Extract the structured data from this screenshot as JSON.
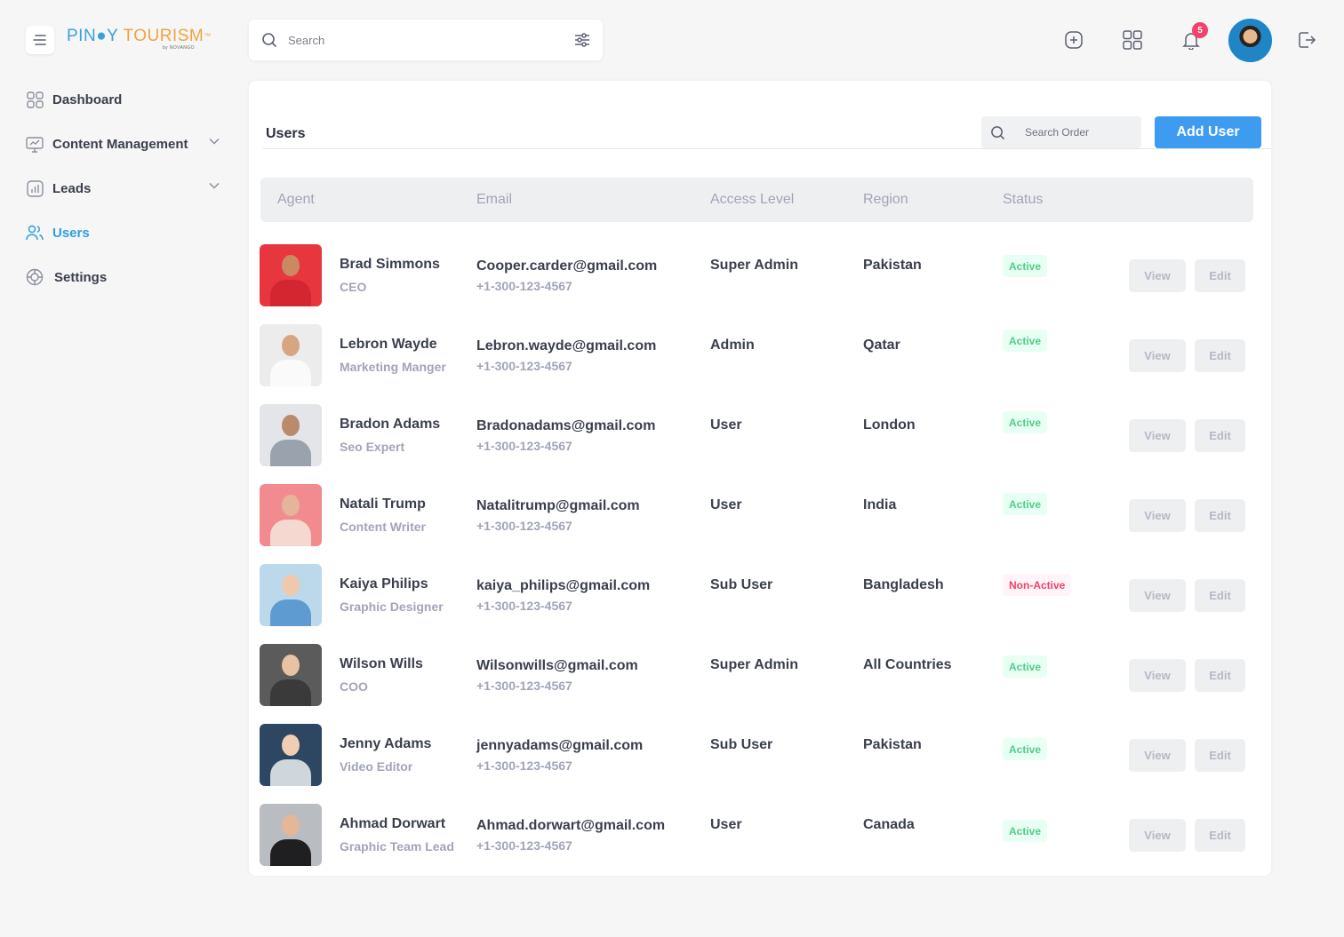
{
  "brand": {
    "part1": "PIN",
    "part2": "Y",
    "part3": "TOURISM",
    "tm": "™",
    "sub": "by NOVANGO"
  },
  "nav": [
    {
      "label": "Dashboard",
      "icon": "dashboard-grid-icon",
      "active": false
    },
    {
      "label": "Content Management",
      "icon": "monitor-icon",
      "active": false,
      "expandable": true
    },
    {
      "label": "Leads",
      "icon": "chart-icon",
      "active": false,
      "expandable": true
    },
    {
      "label": "Users",
      "icon": "users-icon",
      "active": true
    },
    {
      "label": "Settings",
      "icon": "settings-icon",
      "active": false
    }
  ],
  "topbar": {
    "search_placeholder": "Search",
    "notifications_count": "5"
  },
  "users_page": {
    "title": "Users",
    "search_placeholder": "Search Order",
    "add_button": "Add User",
    "columns": {
      "agent": "Agent",
      "email": "Email",
      "access": "Access Level",
      "region": "Region",
      "status": "Status"
    },
    "view_label": "View",
    "edit_label": "Edit",
    "rows": [
      {
        "name": "Brad Simmons",
        "role": "CEO",
        "email": "Cooper.carder@gmail.com",
        "phone": "+1-300-123-4567",
        "access": "Super Admin",
        "region": "Pakistan",
        "status": "Active",
        "active": true,
        "photo_bg": "#e8363f",
        "photo_skin": "#c98a63",
        "photo_shirt": "#d42630"
      },
      {
        "name": "Lebron Wayde",
        "role": "Marketing Manger",
        "email": "Lebron.wayde@gmail.com",
        "phone": "+1-300-123-4567",
        "access": "Admin",
        "region": "Qatar",
        "status": "Active",
        "active": true,
        "photo_bg": "#ececec",
        "photo_skin": "#d8a582",
        "photo_shirt": "#fafafa"
      },
      {
        "name": "Bradon Adams",
        "role": "Seo Expert",
        "email": "Bradonadams@gmail.com",
        "phone": "+1-300-123-4567",
        "access": "User",
        "region": "London",
        "status": "Active",
        "active": true,
        "photo_bg": "#e3e5e8",
        "photo_skin": "#b98a6c",
        "photo_shirt": "#9aa3ad"
      },
      {
        "name": "Natali Trump",
        "role": "Content Writer",
        "email": "Natalitrump@gmail.com",
        "phone": "+1-300-123-4567",
        "access": "User",
        "region": "India",
        "status": "Active",
        "active": true,
        "photo_bg": "#f28b8f",
        "photo_skin": "#e6b49a",
        "photo_shirt": "#f5d8cf"
      },
      {
        "name": "Kaiya Philips",
        "role": "Graphic Designer",
        "email": "kaiya_philips@gmail.com",
        "phone": "+1-300-123-4567",
        "access": "Sub User",
        "region": "Bangladesh",
        "status": "Non-Active",
        "active": false,
        "photo_bg": "#bcd9ec",
        "photo_skin": "#f0c9ad",
        "photo_shirt": "#5d9bd0"
      },
      {
        "name": "Wilson Wills",
        "role": "COO",
        "email": "Wilsonwills@gmail.com",
        "phone": "+1-300-123-4567",
        "access": "Super Admin",
        "region": "All Countries",
        "status": "Active",
        "active": true,
        "photo_bg": "#5b5b5b",
        "photo_skin": "#e8c2a4",
        "photo_shirt": "#3a3a3a"
      },
      {
        "name": "Jenny Adams",
        "role": "Video Editor",
        "email": "jennyadams@gmail.com",
        "phone": "+1-300-123-4567",
        "access": "Sub User",
        "region": "Pakistan",
        "status": "Active",
        "active": true,
        "photo_bg": "#2d4763",
        "photo_skin": "#f0cdb3",
        "photo_shirt": "#cfd6dc"
      },
      {
        "name": "Ahmad Dorwart",
        "role": "Graphic Team Lead",
        "email": "Ahmad.dorwart@gmail.com",
        "phone": "+1-300-123-4567",
        "access": "User",
        "region": "Canada",
        "status": "Active",
        "active": true,
        "photo_bg": "#b9bdc2",
        "photo_skin": "#e5b698",
        "photo_shirt": "#1f1f22"
      }
    ]
  },
  "colors": {
    "accent": "#3d9cf0",
    "active_nav": "#2f9ee0",
    "status_active": "#50cd89",
    "status_inactive": "#f1416c"
  }
}
